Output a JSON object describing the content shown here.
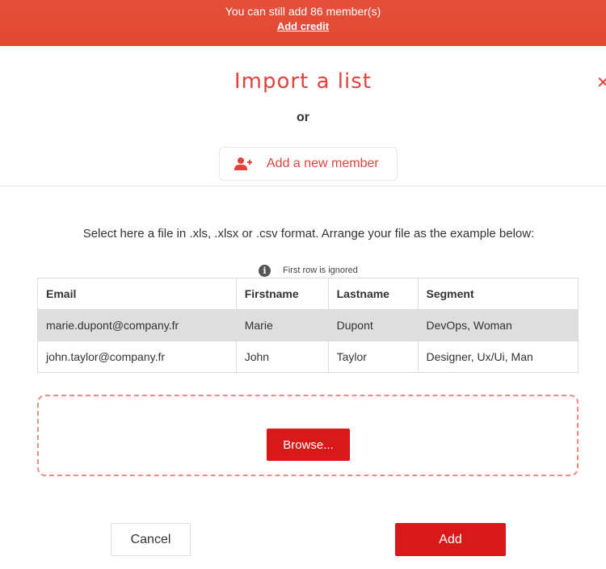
{
  "banner": {
    "text": "You can still add 86 member(s)",
    "link": "Add credit",
    "color": "#e2472f"
  },
  "modal": {
    "title": "Import a list",
    "close_icon": "close-icon",
    "or_text": "or",
    "add_member": {
      "label": "Add a new member",
      "icon": "user-plus-icon"
    },
    "instructions": "Select here a file in .xls, .xlsx or .csv format. Arrange your file as the example below:",
    "note": {
      "icon": "info-icon",
      "text": "First row is ignored"
    },
    "table": {
      "headers": [
        "Email",
        "Firstname",
        "Lastname",
        "Segment"
      ],
      "rows": [
        [
          "marie.dupont@company.fr",
          "Marie",
          "Dupont",
          "DevOps, Woman"
        ],
        [
          "john.taylor@company.fr",
          "John",
          "Taylor",
          "Designer, Ux/Ui, Man"
        ]
      ]
    },
    "browse_label": "Browse...",
    "cancel_label": "Cancel",
    "add_label": "Add",
    "accent_color": "#d81919"
  }
}
